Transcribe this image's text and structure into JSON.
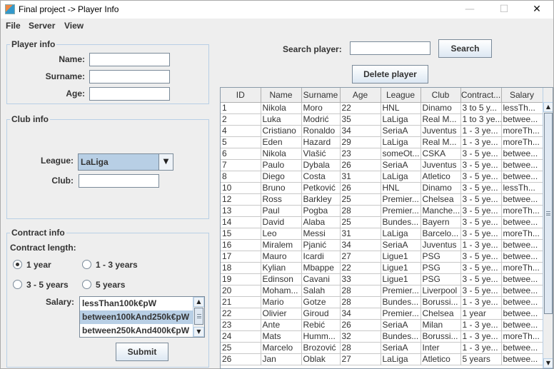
{
  "window": {
    "title": "Final project -> Player Info",
    "minimize": "—",
    "maximize": "☐",
    "close": "✕"
  },
  "menu": [
    "File",
    "Server",
    "View"
  ],
  "player_info": {
    "title": "Player info",
    "name_label": "Name:",
    "surname_label": "Surname:",
    "age_label": "Age:",
    "name_value": "",
    "surname_value": "",
    "age_value": ""
  },
  "club_info": {
    "title": "Club info",
    "league_label": "League:",
    "league_value": "LaLiga",
    "club_label": "Club:",
    "club_value": ""
  },
  "contract_info": {
    "title": "Contract info",
    "length_label": "Contract length:",
    "options": [
      "1 year",
      "1 - 3 years",
      "3 - 5 years",
      "5 years"
    ],
    "selected_option": "1 year",
    "salary_label": "Salary:",
    "salary_options": [
      "lessThan100k€pW",
      "between100kAnd250k€pW",
      "between250kAnd400k€pW"
    ],
    "salary_selected": "between100kAnd250k€pW",
    "submit_label": "Submit"
  },
  "search": {
    "label": "Search player:",
    "value": "",
    "button_label": "Search",
    "delete_label": "Delete player"
  },
  "table": {
    "columns": [
      "ID",
      "Name",
      "Surname",
      "Age",
      "League",
      "Club",
      "Contract...",
      "Salary"
    ],
    "rows": [
      [
        "1",
        "Nikola",
        "Moro",
        "22",
        "HNL",
        "Dinamo",
        "3 to 5 y...",
        "lessTh..."
      ],
      [
        "2",
        "Luka",
        "Modrić",
        "35",
        "LaLiga",
        "Real M...",
        "1 to 3 ye...",
        "betwee..."
      ],
      [
        "4",
        "Cristiano",
        "Ronaldo",
        "34",
        "SeriaA",
        "Juventus",
        "1 - 3 ye...",
        "moreTh..."
      ],
      [
        "5",
        "Eden",
        "Hazard",
        "29",
        "LaLiga",
        "Real M...",
        "1 - 3 ye...",
        "moreTh..."
      ],
      [
        "6",
        "Nikola",
        "Vlašić",
        "23",
        "someOt...",
        "CSKA",
        "3 - 5 ye...",
        "betwee..."
      ],
      [
        "7",
        "Paulo",
        "Dybala",
        "26",
        "SeriaA",
        "Juventus",
        "3 - 5 ye...",
        "betwee..."
      ],
      [
        "8",
        "Diego",
        "Costa",
        "31",
        "LaLiga",
        "Atletico",
        "3 - 5 ye...",
        "betwee..."
      ],
      [
        "10",
        "Bruno",
        "Petković",
        "26",
        "HNL",
        "Dinamo",
        "3 - 5 ye...",
        "lessTh..."
      ],
      [
        "12",
        "Ross",
        "Barkley",
        "25",
        "Premier...",
        "Chelsea",
        "3 - 5 ye...",
        "betwee..."
      ],
      [
        "13",
        "Paul",
        "Pogba",
        "28",
        "Premier...",
        "Manche...",
        "3 - 5 ye...",
        "moreTh..."
      ],
      [
        "14",
        "David",
        "Alaba",
        "25",
        "Bundes...",
        "Bayern",
        "3 - 5 ye...",
        "betwee..."
      ],
      [
        "15",
        "Leo",
        "Messi",
        "31",
        "LaLiga",
        "Barcelo...",
        "3 - 5 ye...",
        "moreTh..."
      ],
      [
        "16",
        "Miralem",
        "Pjanić",
        "34",
        "SeriaA",
        "Juventus",
        "1 - 3 ye...",
        "betwee..."
      ],
      [
        "17",
        "Mauro",
        "Icardi",
        "27",
        "Ligue1",
        "PSG",
        "3 - 5 ye...",
        "betwee..."
      ],
      [
        "18",
        "Kylian",
        "Mbappe",
        "22",
        "Ligue1",
        "PSG",
        "3 - 5 ye...",
        "moreTh..."
      ],
      [
        "19",
        "Edinson",
        "Cavani",
        "33",
        "Ligue1",
        "PSG",
        "3 - 5 ye...",
        "betwee..."
      ],
      [
        "20",
        "Moham...",
        "Salah",
        "28",
        "Premier...",
        "Liverpool",
        "3 - 5 ye...",
        "betwee..."
      ],
      [
        "21",
        "Mario",
        "Gotze",
        "28",
        "Bundes...",
        "Borussi...",
        "1 - 3 ye...",
        "betwee..."
      ],
      [
        "22",
        "Olivier",
        "Giroud",
        "34",
        "Premier...",
        "Chelsea",
        "1 year",
        "betwee..."
      ],
      [
        "23",
        "Ante",
        "Rebić",
        "26",
        "SeriaA",
        "Milan",
        "1 - 3 ye...",
        "betwee..."
      ],
      [
        "24",
        "Mats",
        "Humm...",
        "32",
        "Bundes...",
        "Borussi...",
        "1 - 3 ye...",
        "moreTh..."
      ],
      [
        "25",
        "Marcelo",
        "Brozović",
        "28",
        "SeriaA",
        "Inter",
        "1 - 3 ye...",
        "betwee..."
      ],
      [
        "26",
        "Jan",
        "Oblak",
        "27",
        "LaLiga",
        "Atletico",
        "5 years",
        "betwee..."
      ]
    ]
  },
  "colors": {
    "selection": "#b8cfe5",
    "border": "#7a8a99",
    "window_bg": "#eeeeee"
  }
}
